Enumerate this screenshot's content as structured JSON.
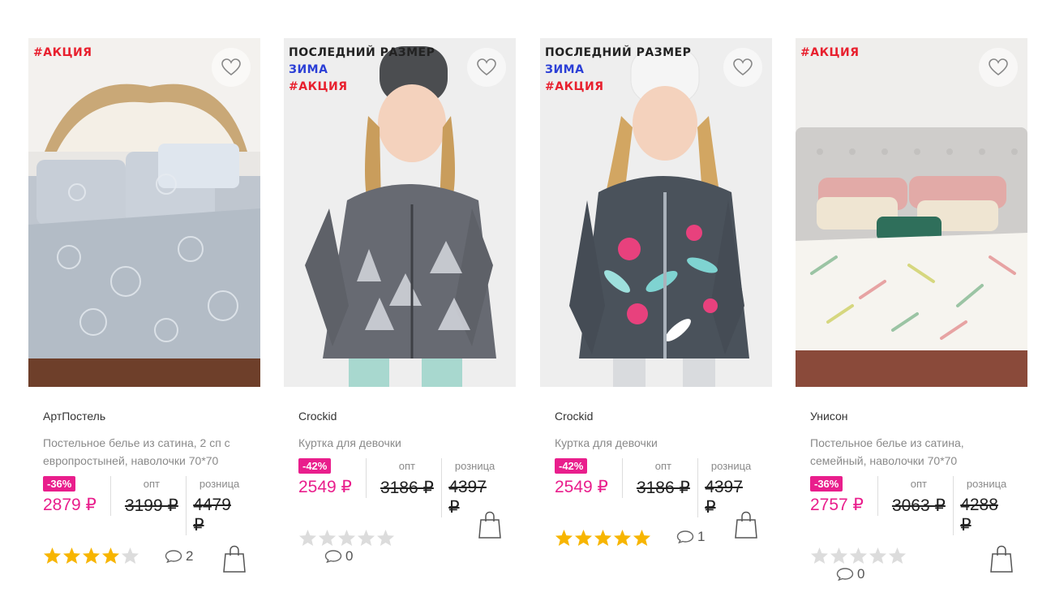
{
  "colors": {
    "accent": "#e91e8c",
    "sale_tag": "#e8202e",
    "winter_tag": "#2b3fd6",
    "star_on": "#f7b500",
    "star_off": "#dcdcdc"
  },
  "products": [
    {
      "tags": {
        "last": "",
        "winter": "",
        "sale": "#АКЦИЯ"
      },
      "brand": "АртПостель",
      "desc": "Постельное белье из сатина, 2 сп с европростыней, наволочки 70*70",
      "discount": "-36%",
      "opt_label": "опт",
      "retail_label": "розница",
      "price": "2879 ₽",
      "opt_price": "3199 ₽",
      "retail_price": "4479 ₽",
      "rating": 4,
      "reviews": "2",
      "image": "bedding-paisley"
    },
    {
      "tags": {
        "last": "ПОСЛЕДНИЙ РАЗМЕР",
        "winter": "ЗИМА",
        "sale": "#АКЦИЯ"
      },
      "brand": "Crockid",
      "desc": "Куртка для девочки",
      "discount": "-42%",
      "opt_label": "опт",
      "retail_label": "розница",
      "price": "2549 ₽",
      "opt_price": "3186 ₽",
      "retail_price": "4397 ₽",
      "rating": 0,
      "reviews": "0",
      "image": "girl-grey-jacket"
    },
    {
      "tags": {
        "last": "ПОСЛЕДНИЙ РАЗМЕР",
        "winter": "ЗИМА",
        "sale": "#АКЦИЯ"
      },
      "brand": "Crockid",
      "desc": "Куртка для девочки",
      "discount": "-42%",
      "opt_label": "опт",
      "retail_label": "розница",
      "price": "2549 ₽",
      "opt_price": "3186 ₽",
      "retail_price": "4397 ₽",
      "rating": 5,
      "reviews": "1",
      "image": "girl-floral-jacket"
    },
    {
      "tags": {
        "last": "",
        "winter": "",
        "sale": "#АКЦИЯ"
      },
      "brand": "Унисон",
      "desc": "Постельное белье из сатина, семейный, наволочки 70*70",
      "discount": "-36%",
      "opt_label": "опт",
      "retail_label": "розница",
      "price": "2757 ₽",
      "opt_price": "3063 ₽",
      "retail_price": "4288 ₽",
      "rating": 0,
      "reviews": "0",
      "image": "bedding-leaves"
    }
  ]
}
